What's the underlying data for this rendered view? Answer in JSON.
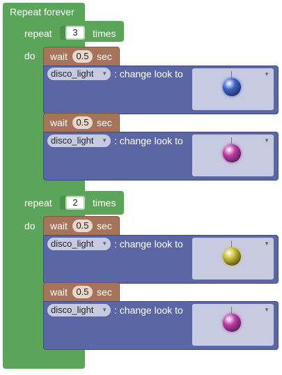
{
  "forever": {
    "label": "Repeat forever"
  },
  "loops": [
    {
      "repeat_label": "repeat",
      "count": "3",
      "times_label": "times",
      "do_label": "do",
      "steps": [
        {
          "wait_label": "wait",
          "seconds": "0.5",
          "sec_label": "sec",
          "sprite": "disco_light",
          "action": ": change look to",
          "look_color": "#3a64c8"
        },
        {
          "wait_label": "wait",
          "seconds": "0.5",
          "sec_label": "sec",
          "sprite": "disco_light",
          "action": ": change look to",
          "look_color": "#c03aa8"
        }
      ]
    },
    {
      "repeat_label": "repeat",
      "count": "2",
      "times_label": "times",
      "do_label": "do",
      "steps": [
        {
          "wait_label": "wait",
          "seconds": "0.5",
          "sec_label": "sec",
          "sprite": "disco_light",
          "action": ": change look to",
          "look_color": "#c8bc2a"
        },
        {
          "wait_label": "wait",
          "seconds": "0.5",
          "sec_label": "sec",
          "sprite": "disco_light",
          "action": ": change look to",
          "look_color": "#c03aa8"
        }
      ]
    }
  ],
  "colors": {
    "loop": "#5ba55b",
    "wait": "#a5745b",
    "look": "#5b67a5"
  },
  "icons": {
    "dropdown": "dropdown-arrow-icon",
    "look": "disco-ball-icon"
  }
}
